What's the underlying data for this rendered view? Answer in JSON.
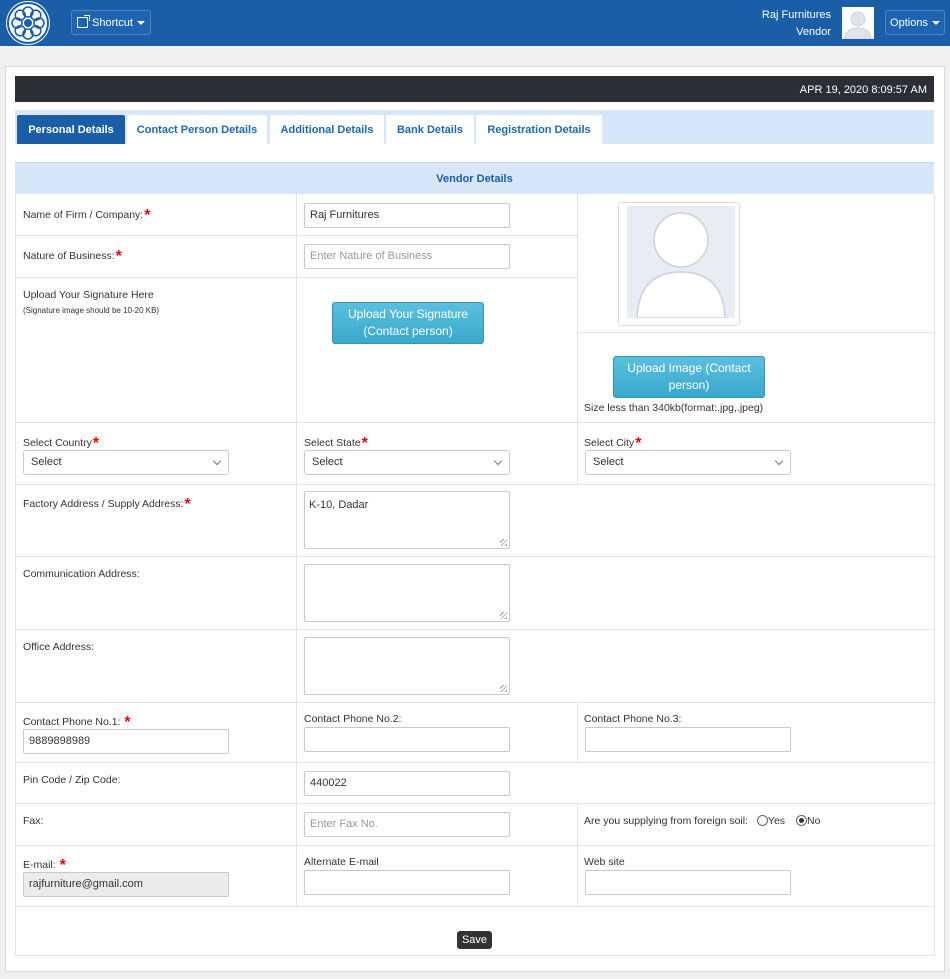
{
  "header": {
    "shortcut_label": "Shortcut",
    "user_name": "Raj Furnitures",
    "user_role": "Vendor",
    "options_label": "Options"
  },
  "datetime": "APR 19, 2020  8:09:57 AM",
  "tabs": [
    {
      "label": "Personal Details",
      "active": true
    },
    {
      "label": "Contact Person Details",
      "active": false
    },
    {
      "label": "Additional Details",
      "active": false
    },
    {
      "label": "Bank Details",
      "active": false
    },
    {
      "label": "Registration Details",
      "active": false
    }
  ],
  "section_title": "Vendor Details",
  "form": {
    "firm_label": "Name of Firm / Company:",
    "firm_value": "Raj Furnitures",
    "nature_label": "Nature of Business:",
    "nature_placeholder": "Enter Nature of Business",
    "signature_label": "Upload Your Signature Here",
    "signature_note": "(Signature image should be 10-20 KB)",
    "signature_button_line1": "Upload Your Signature",
    "signature_button_line2": "(Contact person)",
    "image_button_line1": "Upload Image (Contact",
    "image_button_line2": "person)",
    "image_note": "Size less than 340kb(format:.jpg,.jpeg)",
    "country_label": "Select Country",
    "country_value": "Select",
    "state_label": "Select State",
    "state_value": "Select",
    "city_label": "Select City",
    "city_value": "Select",
    "factory_label": "Factory Address / Supply Address:",
    "factory_value": "K-10, Dadar",
    "communication_label": "Communication Address:",
    "office_label": "Office Address:",
    "phone1_label": "Contact Phone No.1:",
    "phone1_value": "9889898989",
    "phone2_label": "Contact Phone No.2:",
    "phone3_label": "Contact Phone No.3:",
    "pin_label": "Pin Code / Zip Code:",
    "pin_value": "440022",
    "fax_label": "Fax:",
    "fax_placeholder": "Enter Fax No.",
    "foreign_label": "Are you supplying from foreign soil:",
    "foreign_yes": "Yes",
    "foreign_no": "No",
    "foreign_selected": "No",
    "email_label": "E-mail:",
    "email_value": "rajfurniture@gmail.com",
    "alt_email_label": "Alternate E-mail",
    "website_label": "Web site",
    "save_label": "Save"
  },
  "colors": {
    "brand": "#1a5ea8",
    "tab_strip": "#d8e7f7",
    "upload_button": "#4ab3d6",
    "required": "#e00000"
  }
}
